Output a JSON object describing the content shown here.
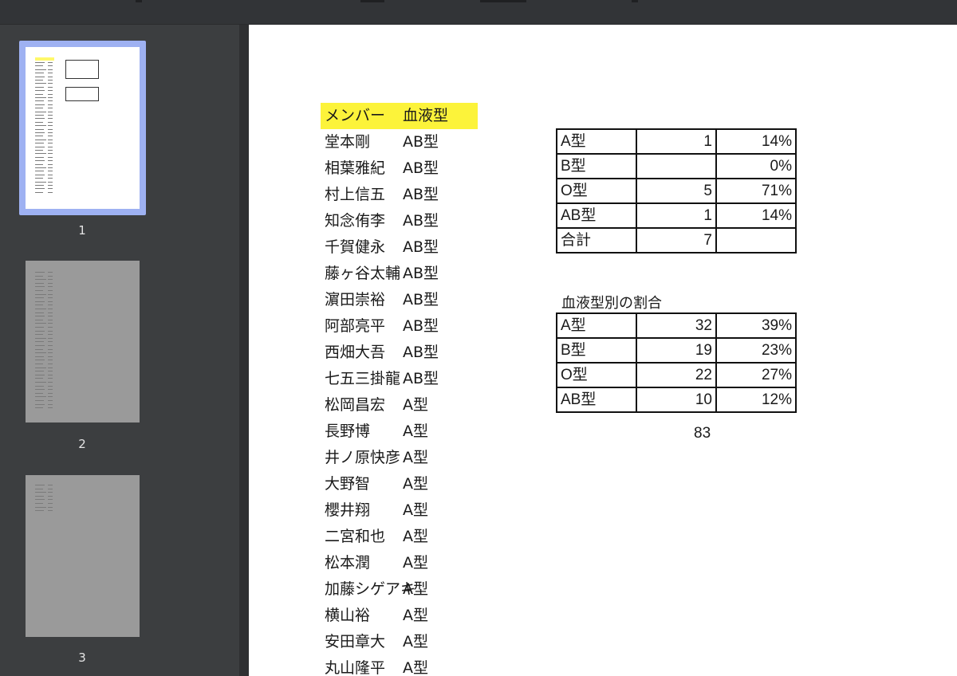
{
  "thumbnails": [
    {
      "label": "1",
      "selected": true
    },
    {
      "label": "2",
      "selected": false
    },
    {
      "label": "3",
      "selected": false
    }
  ],
  "member_table": {
    "header": {
      "name": "メンバー",
      "type": "血液型"
    },
    "rows": [
      {
        "name": "堂本剛",
        "type": "AB型"
      },
      {
        "name": "相葉雅紀",
        "type": "AB型"
      },
      {
        "name": "村上信五",
        "type": "AB型"
      },
      {
        "name": "知念侑李",
        "type": "AB型"
      },
      {
        "name": "千賀健永",
        "type": "AB型"
      },
      {
        "name": "藤ヶ谷太輔",
        "type": "AB型"
      },
      {
        "name": "濵田崇裕",
        "type": "AB型"
      },
      {
        "name": "阿部亮平",
        "type": "AB型"
      },
      {
        "name": "西畑大吾",
        "type": "AB型"
      },
      {
        "name": "七五三掛龍",
        "type": "AB型"
      },
      {
        "name": "松岡昌宏",
        "type": "A型"
      },
      {
        "name": "長野博",
        "type": "A型"
      },
      {
        "name": "井ノ原快彦",
        "type": "A型"
      },
      {
        "name": "大野智",
        "type": "A型"
      },
      {
        "name": "櫻井翔",
        "type": "A型"
      },
      {
        "name": "二宮和也",
        "type": "A型"
      },
      {
        "name": "松本潤",
        "type": "A型"
      },
      {
        "name": "加藤シゲアキ",
        "type": "A型"
      },
      {
        "name": "横山裕",
        "type": "A型"
      },
      {
        "name": "安田章大",
        "type": "A型"
      },
      {
        "name": "丸山隆平",
        "type": "A型"
      }
    ]
  },
  "summary_table_1": {
    "rows": [
      {
        "type": "A型",
        "count": "1",
        "pct": "14%"
      },
      {
        "type": "B型",
        "count": "",
        "pct": "0%"
      },
      {
        "type": "O型",
        "count": "5",
        "pct": "71%"
      },
      {
        "type": "AB型",
        "count": "1",
        "pct": "14%"
      },
      {
        "type": "合計",
        "count": "7",
        "pct": ""
      }
    ]
  },
  "summary_table_2": {
    "caption": "血液型別の割合",
    "rows": [
      {
        "type": "A型",
        "count": "32",
        "pct": "39%"
      },
      {
        "type": "B型",
        "count": "19",
        "pct": "23%"
      },
      {
        "type": "O型",
        "count": "22",
        "pct": "27%"
      },
      {
        "type": "AB型",
        "count": "10",
        "pct": "12%"
      }
    ],
    "total": "83"
  }
}
